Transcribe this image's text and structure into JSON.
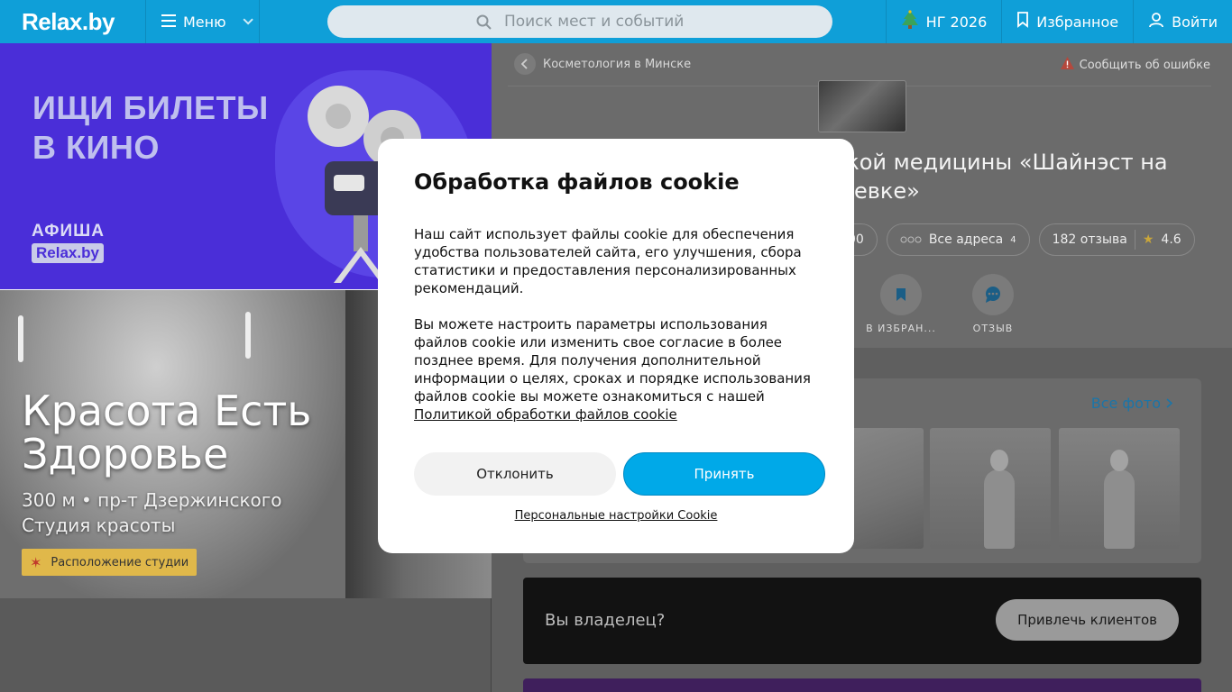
{
  "header": {
    "logo": "Relax.by",
    "menu_label": "Меню",
    "search_placeholder": "Поиск мест и событий",
    "ng_label": "НГ 2026",
    "favorites_label": "Избранное",
    "login_label": "Войти"
  },
  "banner_top": {
    "title_line1": "ИЩИ БИЛЕТЫ",
    "title_line2": "В КИНО",
    "afisha": "АФИША",
    "afisha_logo": "Relax.by"
  },
  "banner_bottom": {
    "title_line1": "Красота Есть",
    "title_line2": "Здоровье",
    "sub_line1": "300 м • пр-т Дзержинского",
    "sub_line2": "Студия красоты",
    "badge": "Расположение студии"
  },
  "place": {
    "breadcrumb": "Косметология в Минске",
    "report": "Сообщить об ошибке",
    "name": "ской медицины «Шайнэст на шевке»",
    "pill_phone": "00",
    "pill_addresses": "Все адреса",
    "pill_addresses_count": "4",
    "reviews": "182 отзыва",
    "rating": "4.6",
    "action_favorites": "В ИЗБРАН...",
    "action_review": "ОТЗЫВ",
    "all_photos": "Все фото"
  },
  "owner": {
    "text": "Вы владелец?",
    "button": "Привлечь клиентов"
  },
  "cookie": {
    "title": "Обработка файлов cookie",
    "para1": "Наш сайт использует файлы cookie для обеспечения удобства пользователей сайта, его улучшения, сбора статистики и предоставления персонализированных рекомендаций.",
    "para2": "Вы можете настроить параметры использования файлов cookie или изменить свое согласие в более позднее время. Для получения дополнительной информации о целях, сроках и порядке использования файлов cookie вы можете ознакомиться с нашей",
    "policy_link": "Политикой обработки файлов cookie",
    "decline": "Отклонить",
    "accept": "Принять",
    "personal": "Персональные настройки Cookie"
  },
  "colors": {
    "header": "#0f9fd8",
    "accept": "#00a9e8",
    "banner": "#4a2ed8"
  }
}
